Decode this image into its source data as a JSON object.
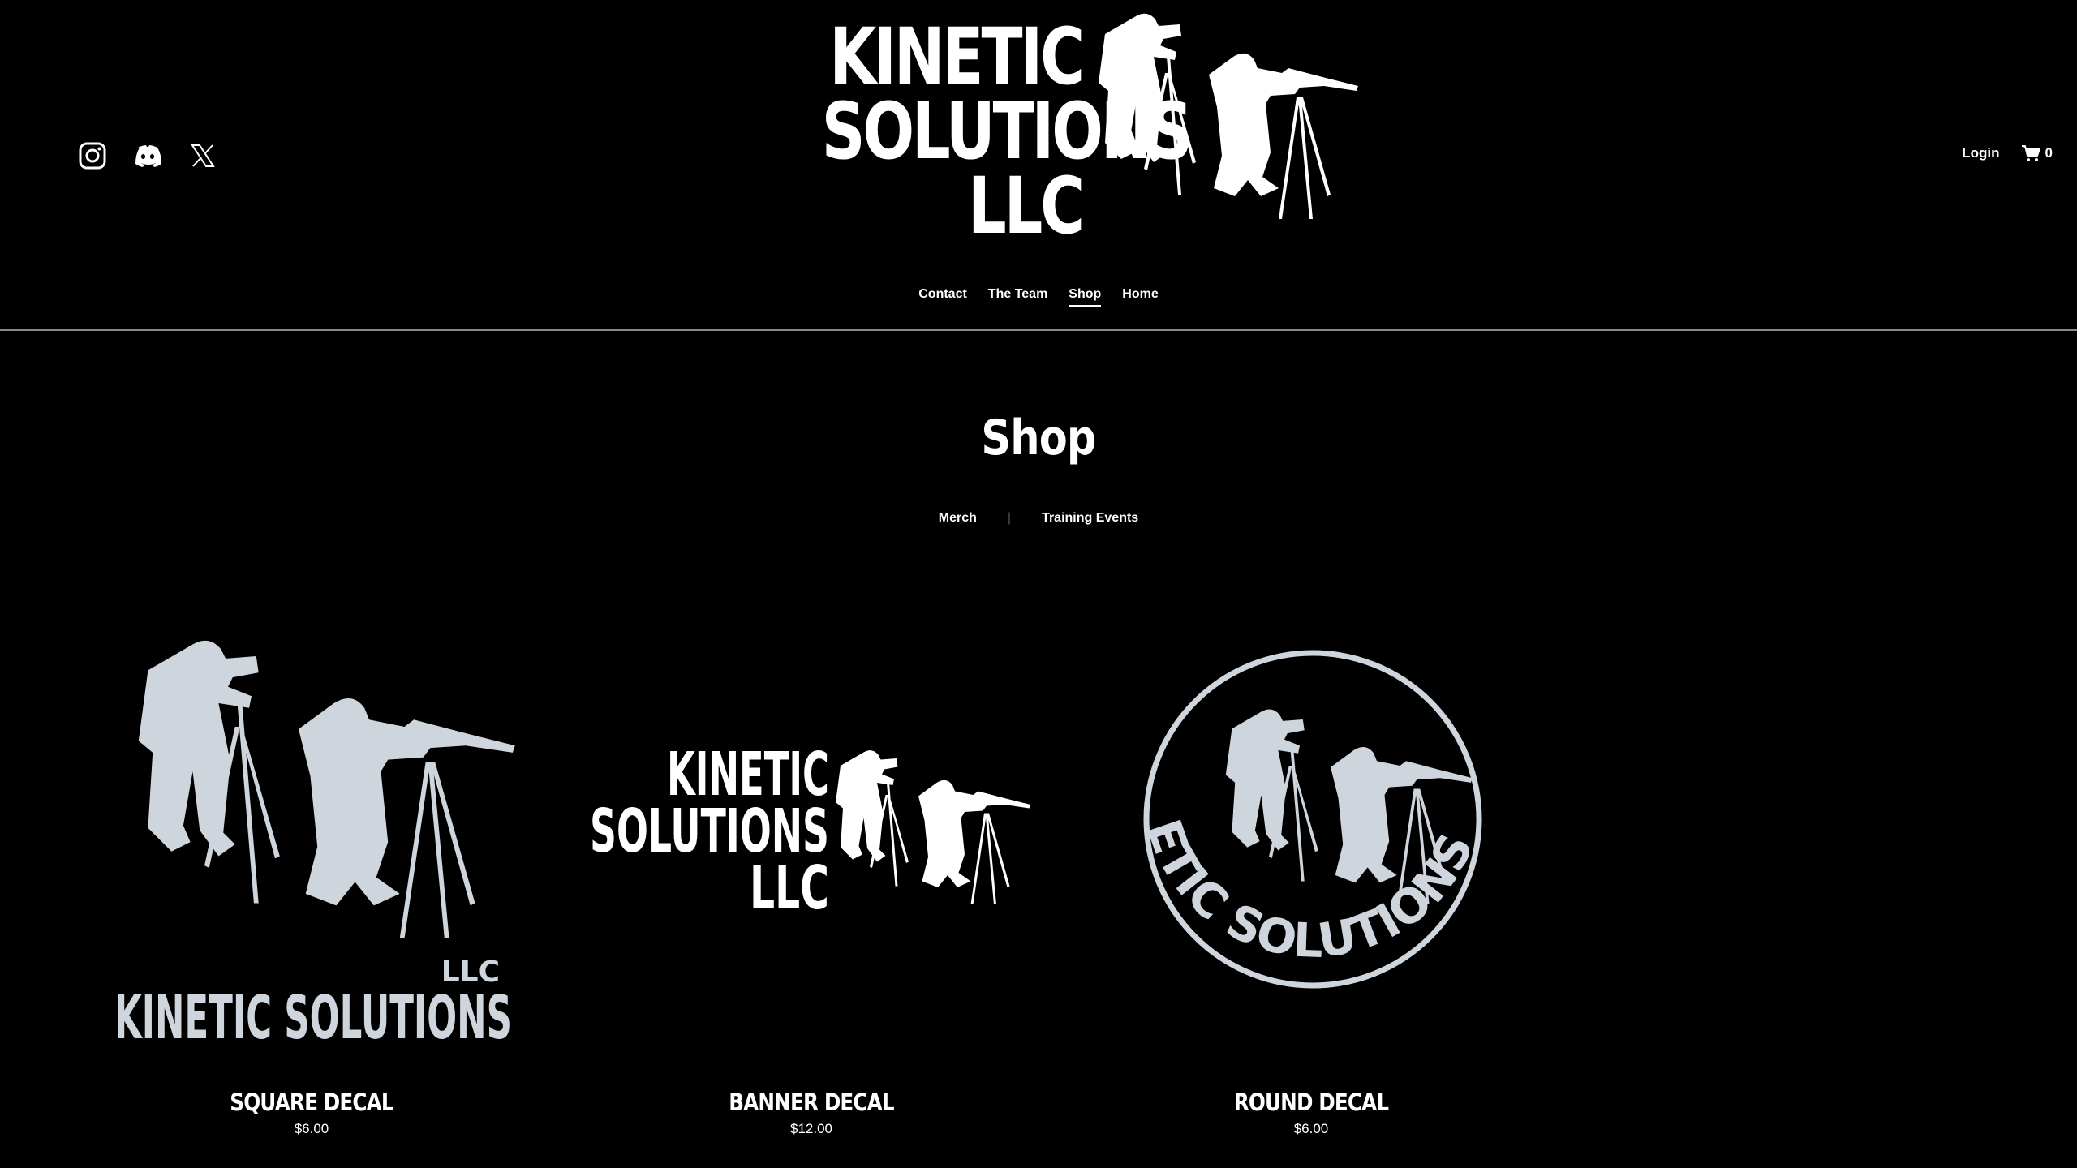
{
  "header": {
    "brand_lines": [
      "KINETIC",
      "SOLUTIONS",
      "LLC"
    ],
    "login": "Login",
    "cart_count": "0",
    "social_icons": [
      "instagram-icon",
      "discord-icon",
      "x-icon"
    ]
  },
  "nav": {
    "items": [
      {
        "label": "Contact"
      },
      {
        "label": "The Team"
      },
      {
        "label": "Shop",
        "active": true
      },
      {
        "label": "Home"
      }
    ]
  },
  "page": {
    "title": "Shop",
    "categories": [
      "Merch",
      "Training Events"
    ],
    "separator": "|"
  },
  "products": [
    {
      "name": "SQUARE DECAL",
      "price": "$6.00",
      "logo_text": "KINETIC SOLUTIONS",
      "logo_suffix": "LLC"
    },
    {
      "name": "BANNER DECAL",
      "price": "$12.00",
      "logo_lines": [
        "KINETIC",
        "SOLUTIONS",
        "LLC"
      ]
    },
    {
      "name": "ROUND DECAL",
      "price": "$6.00",
      "logo_text": "KINETIC SOLUTIONS LLC"
    }
  ],
  "colors": {
    "background": "#000000",
    "text": "#ffffff",
    "decal_gray": "#cfd5dc"
  }
}
